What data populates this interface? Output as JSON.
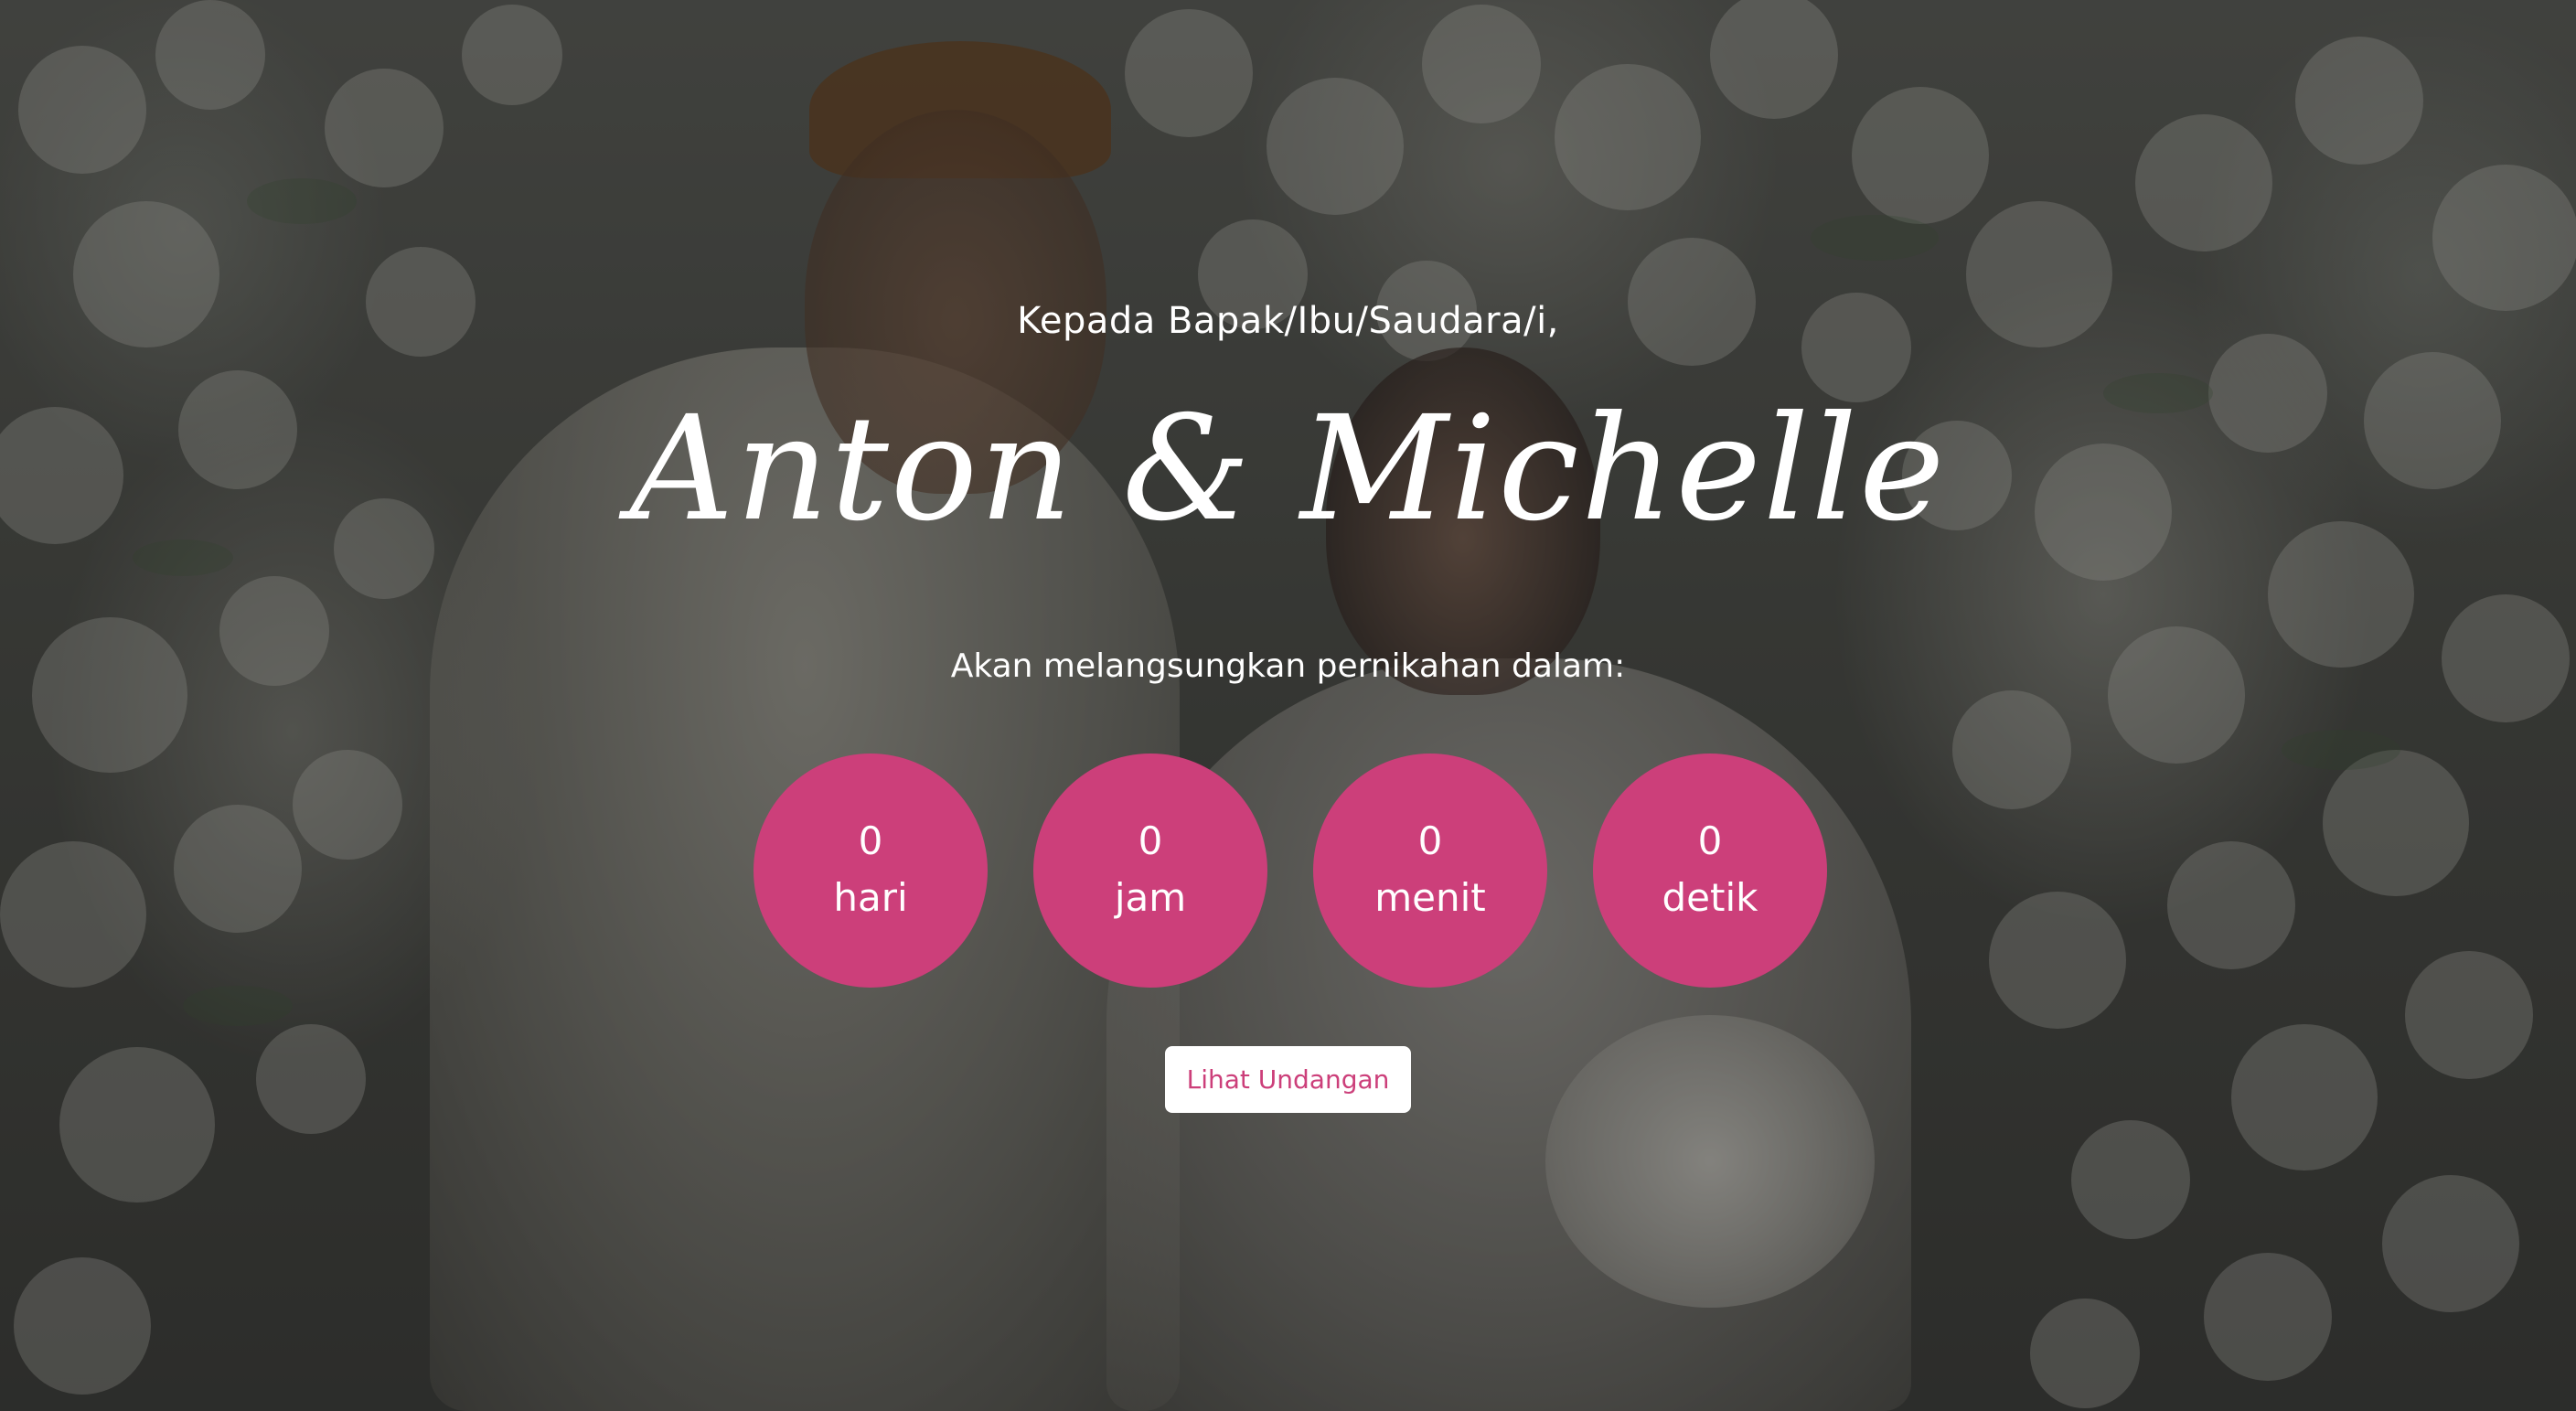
{
  "invitation": {
    "greeting": "Kepada Bapak/Ibu/Saudara/i,",
    "couple_names": "Anton & Michelle",
    "subtitle": "Akan melangsungkan pernikahan dalam:",
    "button_label": "Lihat Undangan"
  },
  "countdown": [
    {
      "value": "0",
      "unit": "hari"
    },
    {
      "value": "0",
      "unit": "jam"
    },
    {
      "value": "0",
      "unit": "menit"
    },
    {
      "value": "0",
      "unit": "detik"
    }
  ],
  "colors": {
    "accent": "#cc3f7a",
    "text": "#ffffff",
    "button_text": "#cc3f7a"
  }
}
